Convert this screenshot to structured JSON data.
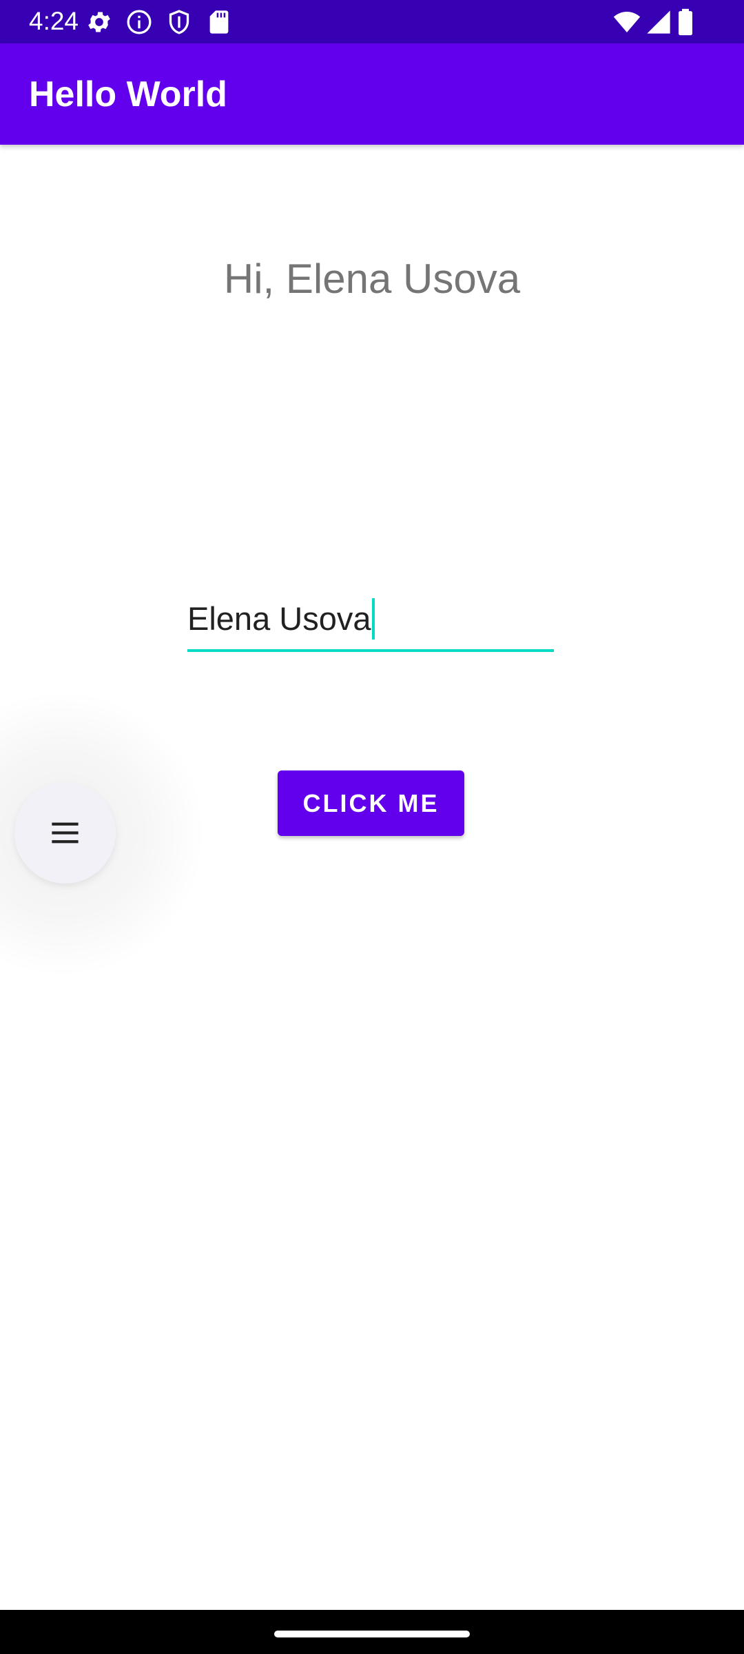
{
  "status_bar": {
    "time": "4:24",
    "left_icons": [
      "settings-icon",
      "info-icon",
      "shield-icon",
      "sd-card-icon"
    ],
    "right_icons": [
      "wifi-icon",
      "signal-icon",
      "battery-icon"
    ]
  },
  "app_bar": {
    "title": "Hello World"
  },
  "main": {
    "greeting": "Hi, Elena Usova",
    "name_input": {
      "value": "Elena Usova"
    },
    "button_label": "CLICK ME"
  },
  "fab": {
    "icon": "menu-icon"
  },
  "colors": {
    "status_bar": "#3700b3",
    "primary": "#6200ee",
    "accent": "#03dac5",
    "greeting_text": "#757575"
  }
}
